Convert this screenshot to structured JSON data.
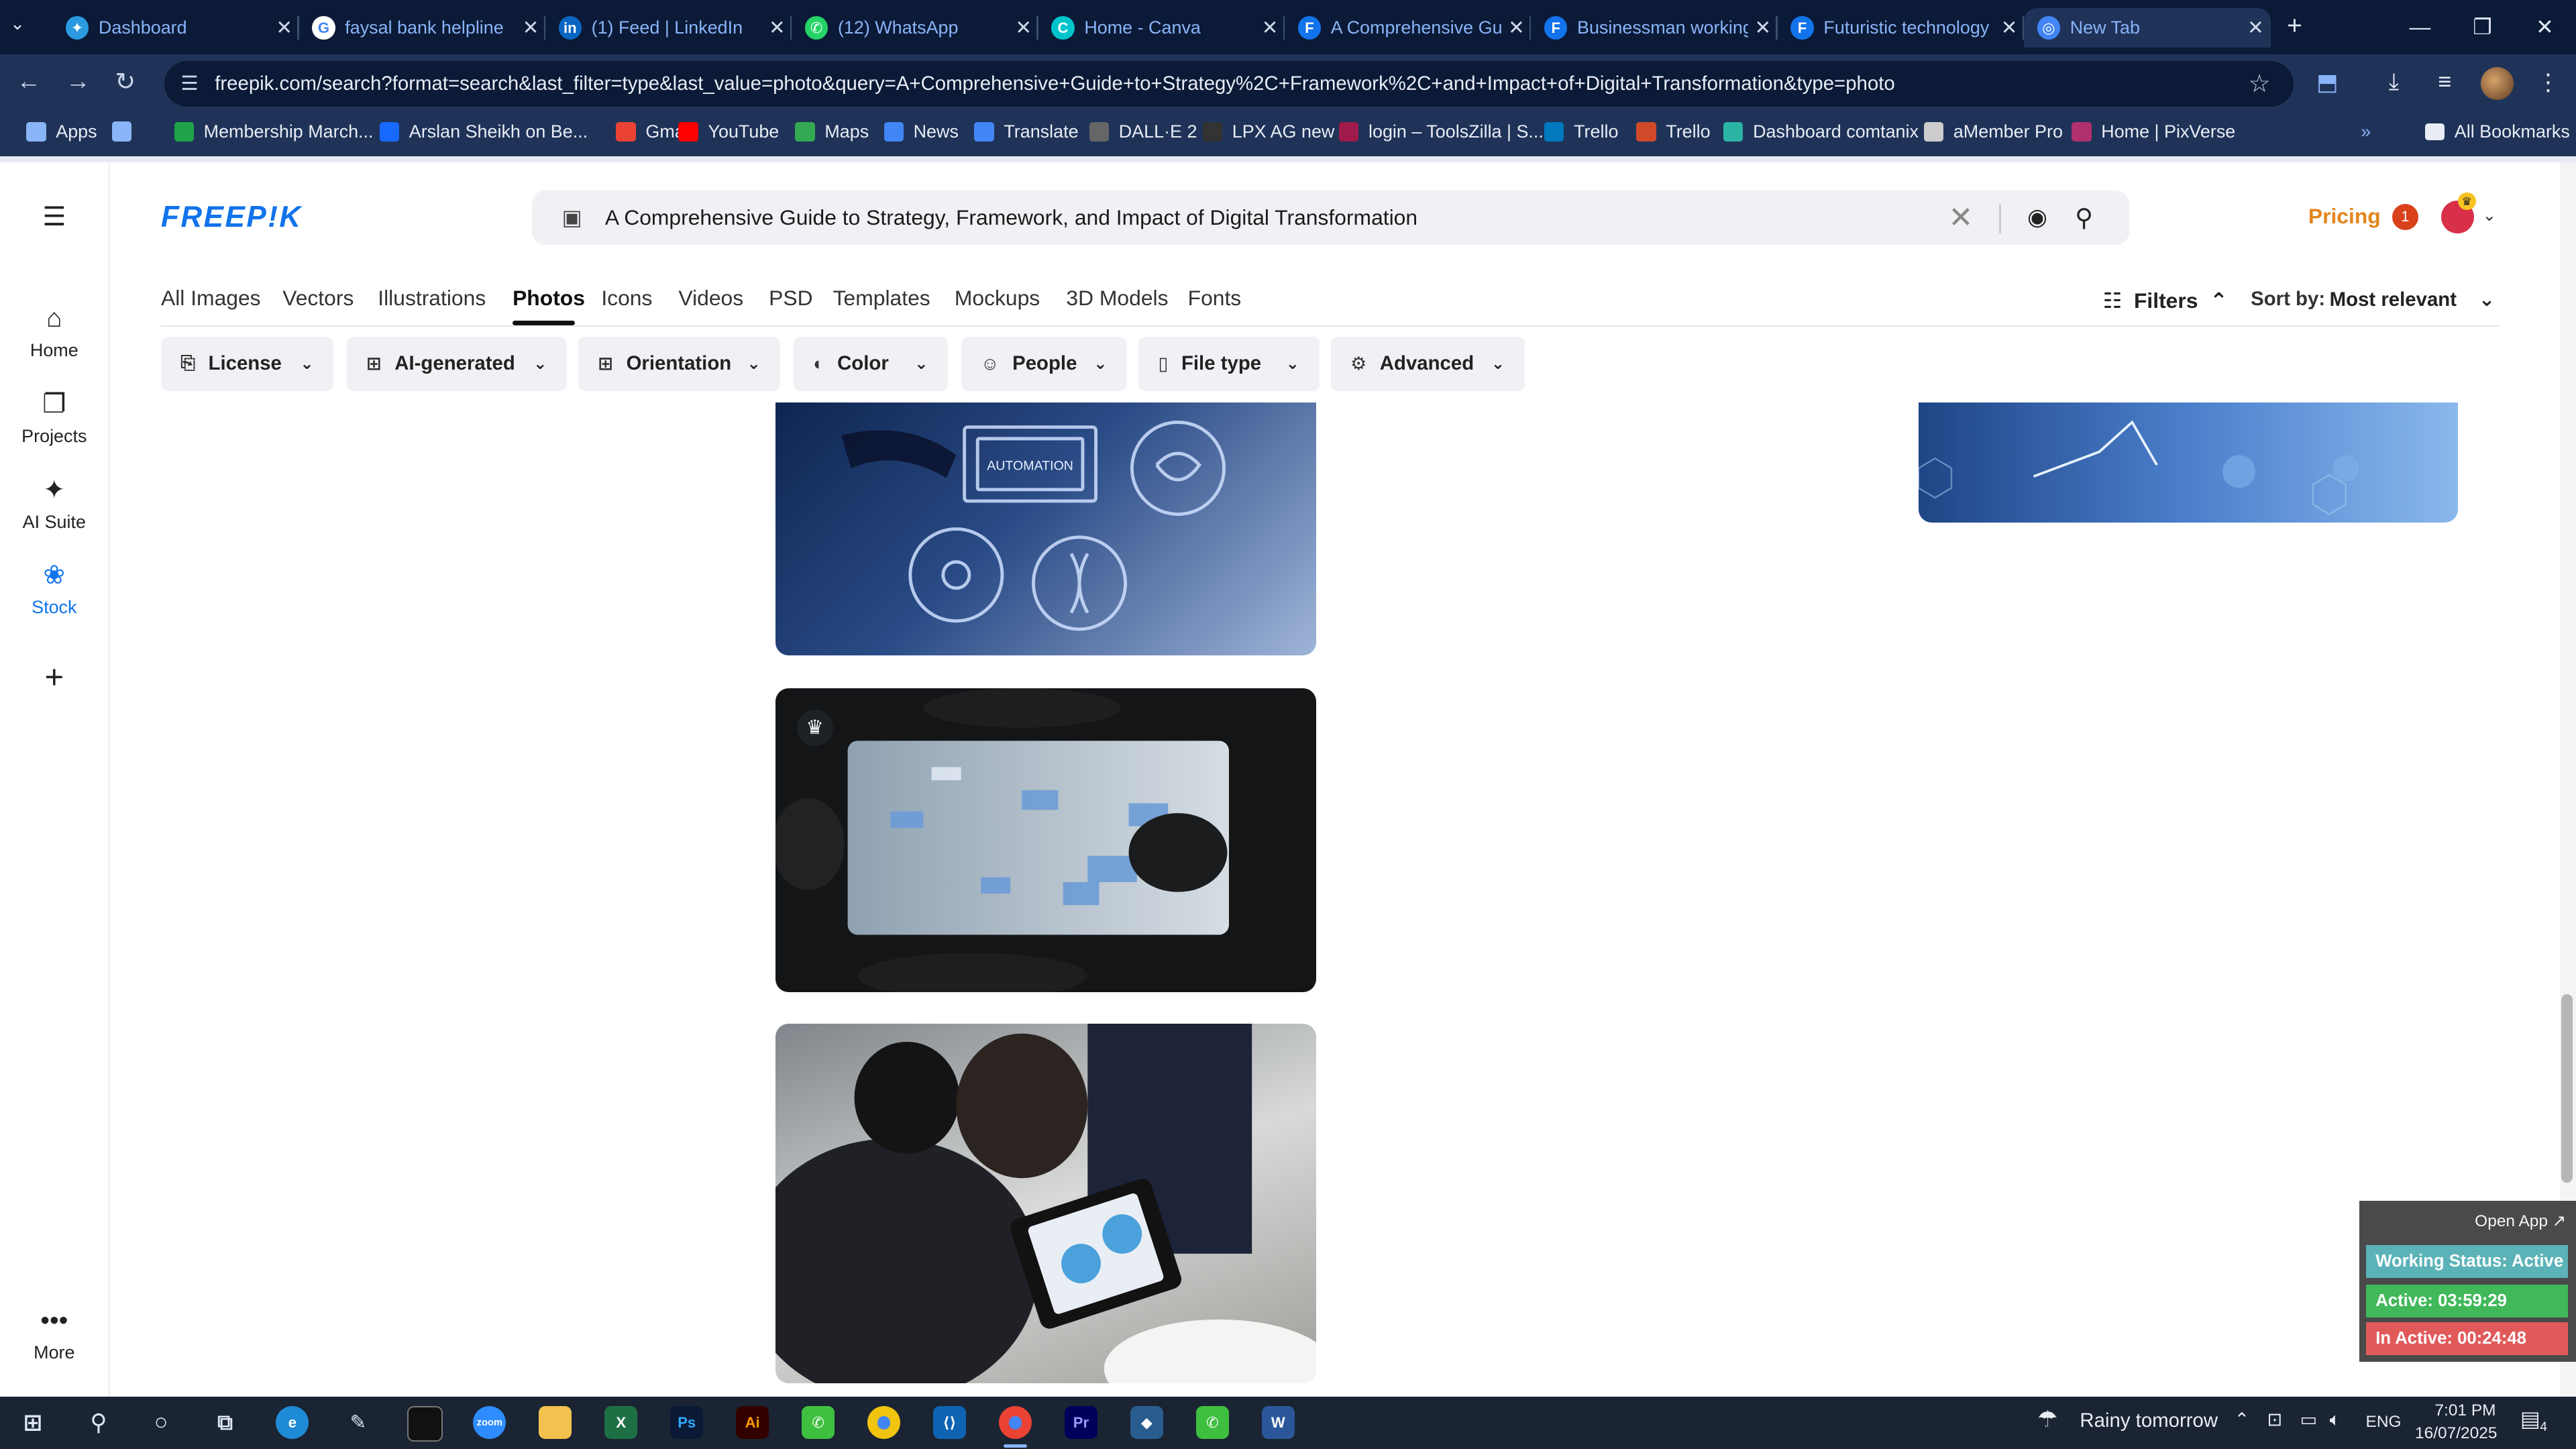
{
  "browser": {
    "tabs": [
      {
        "title": "Dashboard",
        "color": "#2b9ae0",
        "icon": "dashboard-icon",
        "glyph": "✦"
      },
      {
        "title": "faysal bank helpline",
        "color": "#ffffff",
        "icon": "google-icon",
        "glyph": "G"
      },
      {
        "title": "(1) Feed | LinkedIn",
        "color": "#0a66c2",
        "icon": "linkedin-icon",
        "glyph": "in"
      },
      {
        "title": "(12) WhatsApp",
        "color": "#25d366",
        "icon": "whatsapp-icon",
        "glyph": "✆"
      },
      {
        "title": "Home - Canva",
        "color": "#00c4cc",
        "icon": "canva-icon",
        "glyph": "C"
      },
      {
        "title": "A Comprehensive Gu",
        "color": "#1273eb",
        "icon": "freepik-icon",
        "glyph": "F"
      },
      {
        "title": "Businessman working",
        "color": "#1273eb",
        "icon": "freepik-icon",
        "glyph": "F"
      },
      {
        "title": "Futuristic technology",
        "color": "#1273eb",
        "icon": "freepik-icon",
        "glyph": "F"
      },
      {
        "title": "New Tab",
        "color": "#4285f4",
        "icon": "chrome-icon",
        "glyph": "◎"
      }
    ],
    "url": "freepik.com/search?format=search&last_filter=type&last_value=photo&query=A+Comprehensive+Guide+to+Strategy%2C+Framework%2C+and+Impact+of+Digital+Transformation&type=photo",
    "bookmarks": [
      {
        "label": "Apps",
        "color": "#8ab4f8"
      },
      {
        "label": "",
        "color": "#8ab4f8"
      },
      {
        "label": "Membership March...",
        "color": "#1fa34a"
      },
      {
        "label": "Arslan Sheikh on Be...",
        "color": "#1769ff"
      },
      {
        "label": "Gmail",
        "color": "#ea4335"
      },
      {
        "label": "YouTube",
        "color": "#ff0000"
      },
      {
        "label": "Maps",
        "color": "#34a853"
      },
      {
        "label": "News",
        "color": "#4285f4"
      },
      {
        "label": "Translate",
        "color": "#4285f4"
      },
      {
        "label": "DALL·E 2",
        "color": "#666666"
      },
      {
        "label": "LPX AG new",
        "color": "#333333"
      },
      {
        "label": "login – ToolsZilla | S...",
        "color": "#a01b4b"
      },
      {
        "label": "Trello",
        "color": "#0079bf"
      },
      {
        "label": "Trello",
        "color": "#d04a2a"
      },
      {
        "label": "Dashboard comtanix",
        "color": "#2bb3a3"
      },
      {
        "label": "aMember Pro",
        "color": "#cccccc"
      },
      {
        "label": "Home | PixVerse",
        "color": "#b03070"
      }
    ],
    "all_bookmarks": "All Bookmarks"
  },
  "rail": {
    "items": [
      {
        "label": "Home",
        "icon": "home-icon",
        "glyph": "⌂"
      },
      {
        "label": "Projects",
        "icon": "projects-icon",
        "glyph": "❐"
      },
      {
        "label": "AI Suite",
        "icon": "ai-suite-icon",
        "glyph": "✦"
      },
      {
        "label": "Stock",
        "icon": "stock-icon",
        "glyph": "❀"
      }
    ],
    "more": "More"
  },
  "header": {
    "logo": "FREEP!K",
    "search_value": "A Comprehensive Guide to Strategy, Framework, and Impact of Digital Transformation",
    "pricing": "Pricing",
    "notification_count": "1"
  },
  "categories": [
    "All Images",
    "Vectors",
    "Illustrations",
    "Photos",
    "Icons",
    "Videos",
    "PSD",
    "Templates",
    "Mockups",
    "3D Models",
    "Fonts"
  ],
  "active_category": "Photos",
  "toolbar": {
    "filters": "Filters",
    "sort_label": "Sort by:",
    "sort_value": "Most relevant"
  },
  "filter_chips": [
    {
      "label": "License",
      "icon": "license-icon"
    },
    {
      "label": "AI-generated",
      "icon": "ai-generated-icon"
    },
    {
      "label": "Orientation",
      "icon": "orientation-icon"
    },
    {
      "label": "Color",
      "icon": "color-icon"
    },
    {
      "label": "People",
      "icon": "people-icon"
    },
    {
      "label": "File type",
      "icon": "file-type-icon"
    },
    {
      "label": "Advanced",
      "icon": "advanced-icon"
    }
  ],
  "image_labels": {
    "automation": "AUTOMATION"
  },
  "widget": {
    "open_app": "Open App ↗",
    "working_status": "Working Status: Active",
    "active": "Active: 03:59:29",
    "inactive": "In Active: 00:24:48",
    "colors": {
      "status": "#5bb3b8",
      "active": "#41b85a",
      "inactive": "#e05a5a"
    }
  },
  "taskbar": {
    "weather": "Rainy tomorrow",
    "language": "ENG",
    "time": "7:01 PM",
    "date": "16/07/2025",
    "notification_count": "4"
  }
}
